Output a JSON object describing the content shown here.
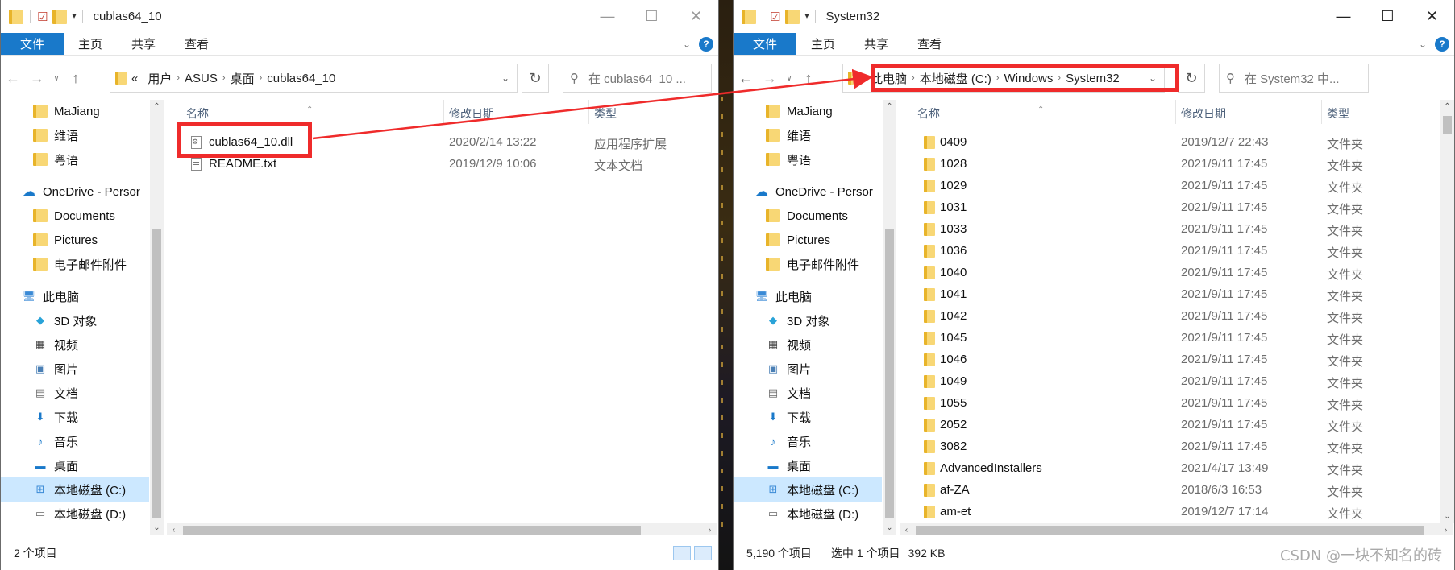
{
  "left_window": {
    "title": "cublas64_10",
    "ribbon_tabs": [
      "文件",
      "主页",
      "共享",
      "查看"
    ],
    "address_prefix": "«",
    "breadcrumbs": [
      "用户",
      "ASUS",
      "桌面",
      "cublas64_10"
    ],
    "search_placeholder": "在 cublas64_10 ...",
    "nav": [
      "MaJiang",
      "维语",
      "粤语",
      "OneDrive - Persor",
      "Documents",
      "Pictures",
      "电子邮件附件",
      "此电脑",
      "3D 对象",
      "视频",
      "图片",
      "文档",
      "下载",
      "音乐",
      "桌面",
      "本地磁盘 (C:)",
      "本地磁盘 (D:)"
    ],
    "columns": [
      "名称",
      "修改日期",
      "类型"
    ],
    "files": [
      {
        "name": "cublas64_10.dll",
        "date": "2020/2/14 13:22",
        "type": "应用程序扩展"
      },
      {
        "name": "README.txt",
        "date": "2019/12/9 10:06",
        "type": "文本文档"
      }
    ],
    "status_count": "2 个项目"
  },
  "right_window": {
    "title": "System32",
    "ribbon_tabs": [
      "文件",
      "主页",
      "共享",
      "查看"
    ],
    "breadcrumbs": [
      "此电脑",
      "本地磁盘 (C:)",
      "Windows",
      "System32"
    ],
    "search_placeholder": "在 System32 中...",
    "nav": [
      "MaJiang",
      "维语",
      "粤语",
      "OneDrive - Persor",
      "Documents",
      "Pictures",
      "电子邮件附件",
      "此电脑",
      "3D 对象",
      "视频",
      "图片",
      "文档",
      "下载",
      "音乐",
      "桌面",
      "本地磁盘 (C:)",
      "本地磁盘 (D:)"
    ],
    "columns": [
      "名称",
      "修改日期",
      "类型"
    ],
    "folders": [
      {
        "name": "0409",
        "date": "2019/12/7 22:43",
        "type": "文件夹"
      },
      {
        "name": "1028",
        "date": "2021/9/11 17:45",
        "type": "文件夹"
      },
      {
        "name": "1029",
        "date": "2021/9/11 17:45",
        "type": "文件夹"
      },
      {
        "name": "1031",
        "date": "2021/9/11 17:45",
        "type": "文件夹"
      },
      {
        "name": "1033",
        "date": "2021/9/11 17:45",
        "type": "文件夹"
      },
      {
        "name": "1036",
        "date": "2021/9/11 17:45",
        "type": "文件夹"
      },
      {
        "name": "1040",
        "date": "2021/9/11 17:45",
        "type": "文件夹"
      },
      {
        "name": "1041",
        "date": "2021/9/11 17:45",
        "type": "文件夹"
      },
      {
        "name": "1042",
        "date": "2021/9/11 17:45",
        "type": "文件夹"
      },
      {
        "name": "1045",
        "date": "2021/9/11 17:45",
        "type": "文件夹"
      },
      {
        "name": "1046",
        "date": "2021/9/11 17:45",
        "type": "文件夹"
      },
      {
        "name": "1049",
        "date": "2021/9/11 17:45",
        "type": "文件夹"
      },
      {
        "name": "1055",
        "date": "2021/9/11 17:45",
        "type": "文件夹"
      },
      {
        "name": "2052",
        "date": "2021/9/11 17:45",
        "type": "文件夹"
      },
      {
        "name": "3082",
        "date": "2021/9/11 17:45",
        "type": "文件夹"
      },
      {
        "name": "AdvancedInstallers",
        "date": "2021/4/17 13:49",
        "type": "文件夹"
      },
      {
        "name": "af-ZA",
        "date": "2018/6/3 16:53",
        "type": "文件夹"
      },
      {
        "name": "am-et",
        "date": "2019/12/7 17:14",
        "type": "文件夹"
      }
    ],
    "status_count": "5,190 个项目",
    "status_selected": "选中 1 个项目",
    "status_size": "392 KB"
  },
  "watermark": "CSDN @一块不知名的砖",
  "colors": {
    "ribbon_file": "#1979ca",
    "highlight": "#ef2b2b",
    "selected_nav": "#cce8ff"
  }
}
